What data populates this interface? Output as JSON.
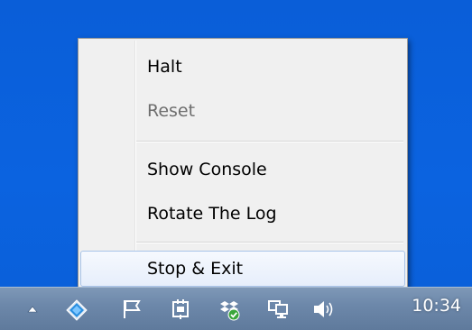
{
  "context_menu": {
    "items": [
      {
        "label": "Halt",
        "enabled": true
      },
      {
        "label": "Reset",
        "enabled": false
      },
      {
        "label": "Show Console",
        "enabled": true
      },
      {
        "label": "Rotate The Log",
        "enabled": true
      },
      {
        "label": "Stop & Exit",
        "enabled": true,
        "highlighted": true
      }
    ]
  },
  "tray": {
    "icons": [
      "show-hidden-icons-arrow-icon",
      "app-diamond-icon",
      "action-center-flag-icon",
      "power-plug-icon",
      "dropbox-synced-icon",
      "network-icon",
      "volume-icon"
    ],
    "clock": "10:34"
  },
  "colors": {
    "desktop": "#0a5ed8",
    "menu_background": "#f0f0f0",
    "highlight_border": "#a8c3e8",
    "taskbar": "#6d88aa",
    "dropbox_blue": "#3d8be3",
    "check_green": "#3aa63a"
  }
}
